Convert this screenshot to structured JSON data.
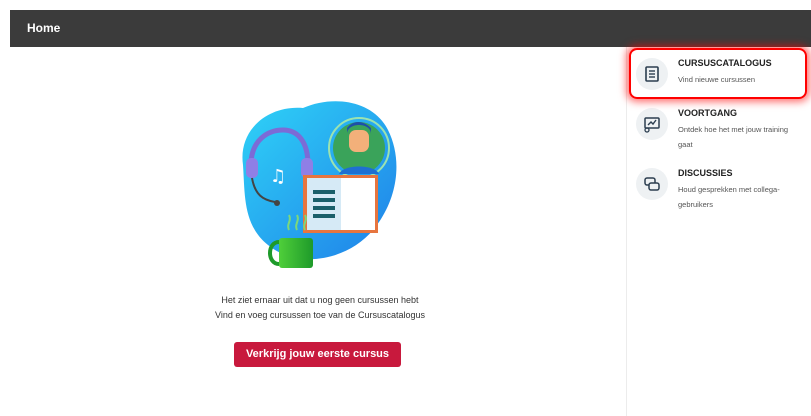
{
  "header": {
    "title": "Home"
  },
  "empty_state": {
    "line1": "Het ziet ernaar uit dat u nog geen cursussen hebt",
    "line2": "Vind en voeg cursussen toe van de Cursuscatalogus",
    "cta_label": "Verkrijg jouw eerste cursus"
  },
  "sidebar": {
    "items": [
      {
        "title": "CURSUSCATALOGUS",
        "desc": "Vind nieuwe cursussen",
        "icon": "book-icon"
      },
      {
        "title": "VOORTGANG",
        "desc": "Ontdek hoe het met jouw training gaat",
        "icon": "progress-chart-icon"
      },
      {
        "title": "DISCUSSIES",
        "desc": "Houd gesprekken met collega-gebruikers",
        "icon": "chat-bubbles-icon"
      }
    ]
  },
  "colors": {
    "topbar": "#3b3b3b",
    "cta": "#c8193d",
    "highlight": "#ff0000"
  }
}
